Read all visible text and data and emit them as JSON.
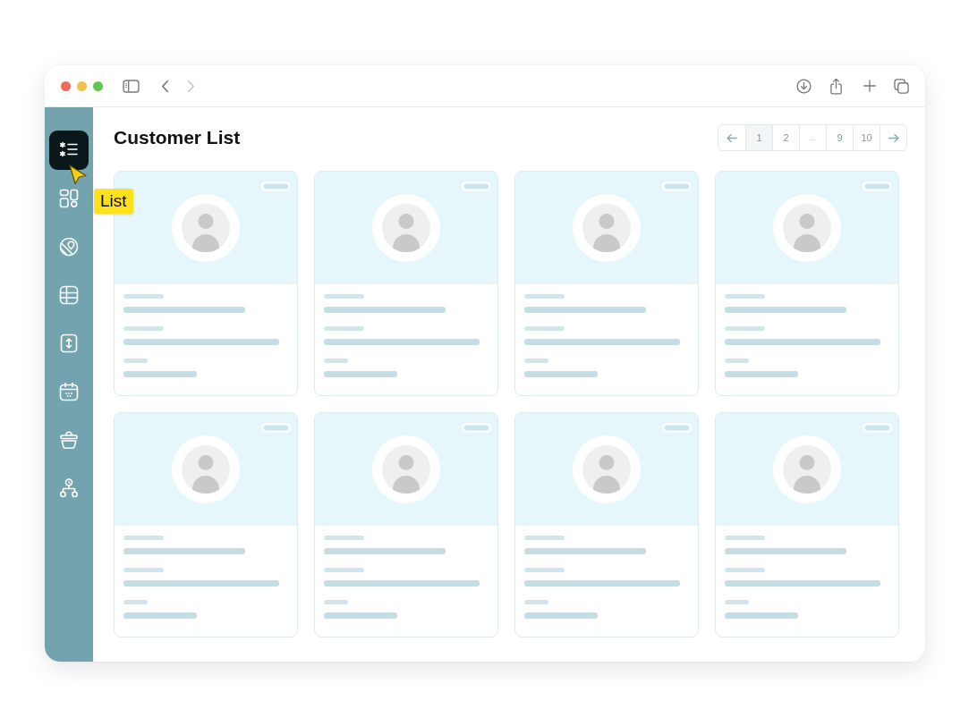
{
  "browser": {
    "back": {
      "disabled": false
    },
    "forward": {
      "disabled": true
    }
  },
  "sidebar": {
    "items": [
      {
        "selected": true
      },
      {
        "selected": false
      },
      {
        "selected": false
      },
      {
        "selected": false
      },
      {
        "selected": false
      },
      {
        "selected": false
      },
      {
        "selected": false
      },
      {
        "selected": false
      }
    ],
    "tooltip": {
      "text": "List"
    }
  },
  "page": {
    "title": "Customer List"
  },
  "pagination": {
    "pages": [
      {
        "kind": "page",
        "label": "1",
        "selected": true
      },
      {
        "kind": "page",
        "label": "2",
        "selected": false
      },
      {
        "kind": "ellipsis",
        "label": "...",
        "selected": false
      },
      {
        "kind": "page",
        "label": "9",
        "selected": false
      },
      {
        "kind": "page",
        "label": "10",
        "selected": false
      }
    ]
  },
  "cards": [
    {
      "kind": "placeholder"
    },
    {
      "kind": "placeholder"
    },
    {
      "kind": "placeholder"
    },
    {
      "kind": "placeholder"
    },
    {
      "kind": "placeholder"
    },
    {
      "kind": "placeholder"
    },
    {
      "kind": "placeholder"
    },
    {
      "kind": "placeholder"
    }
  ]
}
